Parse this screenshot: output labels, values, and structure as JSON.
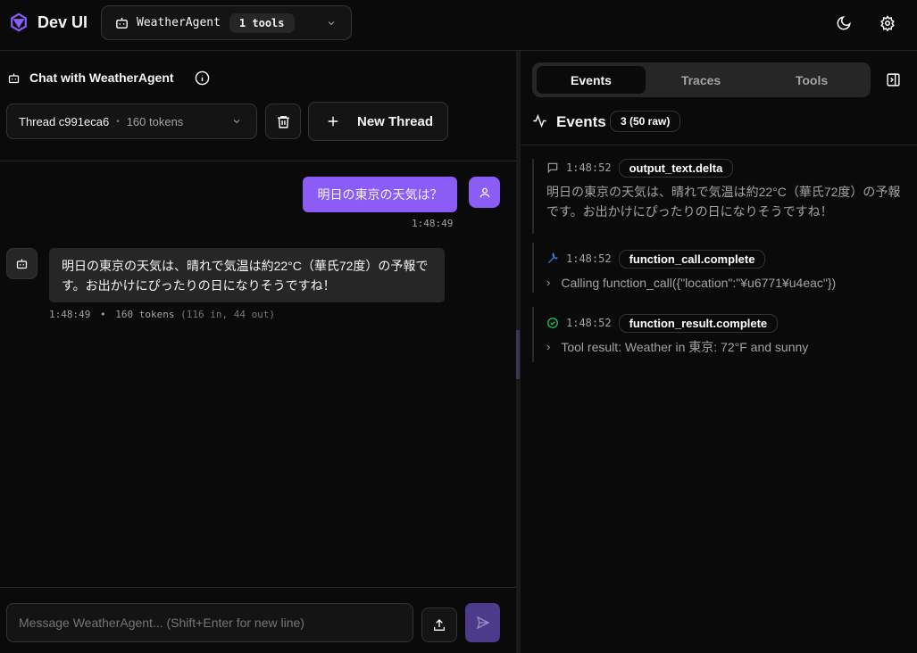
{
  "app": {
    "title": "Dev UI"
  },
  "agent_selector": {
    "name": "WeatherAgent",
    "tools_badge": "1 tools"
  },
  "chat": {
    "title": "Chat with WeatherAgent",
    "thread": {
      "name": "Thread c991eca6",
      "separator": "•",
      "tokens": "160 tokens"
    },
    "new_thread_label": "New Thread",
    "messages": [
      {
        "role": "user",
        "text": "明日の東京の天気は？",
        "time": "1:48:49"
      },
      {
        "role": "assistant",
        "text": "明日の東京の天気は、晴れで気温は約22°C（華氏72度）の予報です。お出かけにぴったりの日になりそうですね！",
        "time": "1:48:49",
        "sep": "•",
        "tokens": "160 tokens",
        "detail": "(116 in, 44 out)"
      }
    ],
    "input_placeholder": "Message WeatherAgent... (Shift+Enter for new line)"
  },
  "right_panel": {
    "tabs": [
      "Events",
      "Traces",
      "Tools"
    ],
    "events_title": "Events",
    "events_count": "3 (50 raw)",
    "events": [
      {
        "icon": "message-icon",
        "time": "1:48:52",
        "type": "output_text.delta",
        "body": "明日の東京の天気は、晴れで気温は約22°C（華氏72度）の予報です。お出かけにぴったりの日になりそうですね！"
      },
      {
        "icon": "wrench-icon",
        "time": "1:48:52",
        "type": "function_call.complete",
        "body": "Calling function_call({\"location\":\"¥u6771¥u4eac\"})"
      },
      {
        "icon": "check-circle-icon",
        "time": "1:48:52",
        "type": "function_result.complete",
        "body": "Tool result: Weather in 東京: 72°F and sunny"
      }
    ]
  },
  "colors": {
    "accent": "#8b5cf6",
    "send_disabled": "#4c3a8a",
    "wrench": "#3b82f6",
    "success": "#22c55e"
  }
}
